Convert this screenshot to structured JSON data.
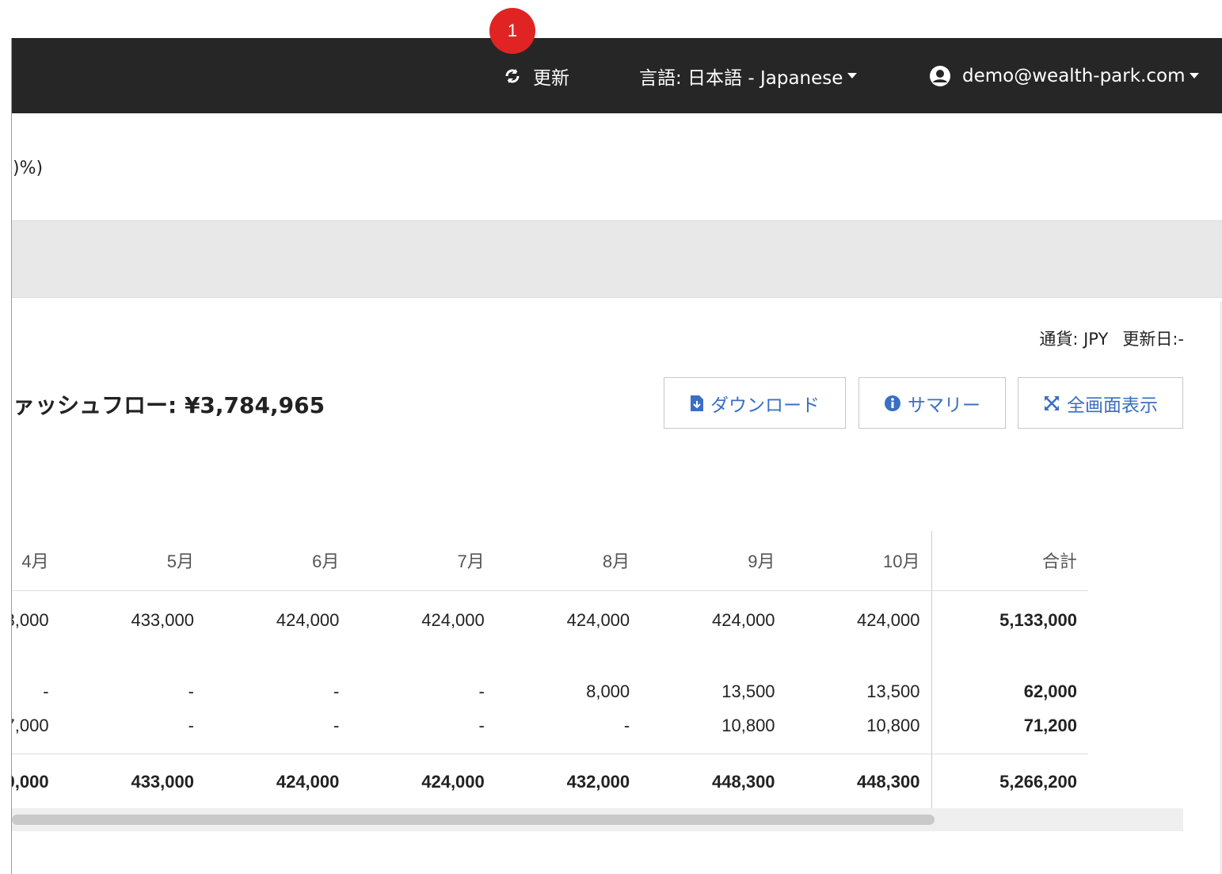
{
  "badge": {
    "number": "1"
  },
  "navbar": {
    "refresh_label": "更新",
    "language_label": "言語: 日本語 - Japanese",
    "user_email": "demo@wealth-park.com"
  },
  "summary": {
    "percent_fragment": ")%)"
  },
  "meta": {
    "currency": "通貨: JPY",
    "updated": "更新日:-"
  },
  "cashflow": {
    "title": "ァッシュフロー: ¥3,784,965"
  },
  "buttons": {
    "download": "ダウンロード",
    "summary": "サマリー",
    "fullscreen": "全画面表示"
  },
  "table": {
    "headers": [
      "4月",
      "5月",
      "6月",
      "7月",
      "8月",
      "9月",
      "10月",
      "合計"
    ],
    "rows": [
      [
        "8,000",
        "433,000",
        "424,000",
        "424,000",
        "424,000",
        "424,000",
        "424,000",
        "5,133,000"
      ],
      [
        "-",
        "-",
        "-",
        "-",
        "8,000",
        "13,500",
        "13,500",
        "62,000"
      ],
      [
        "7,000",
        "-",
        "-",
        "-",
        "-",
        "10,800",
        "10,800",
        "71,200"
      ]
    ],
    "total_row": [
      "0,000",
      "433,000",
      "424,000",
      "424,000",
      "432,000",
      "448,300",
      "448,300",
      "5,266,200"
    ]
  },
  "scrollbar": {
    "position_fraction": 0.79
  },
  "colors": {
    "navbar": "#262626",
    "accent": "#3a6fc4",
    "badge": "#e02424"
  },
  "icons": {
    "refresh": "refresh-icon",
    "user": "user-circle-icon",
    "download": "file-download-icon",
    "summary": "info-circle-icon",
    "fullscreen": "expand-icon"
  }
}
